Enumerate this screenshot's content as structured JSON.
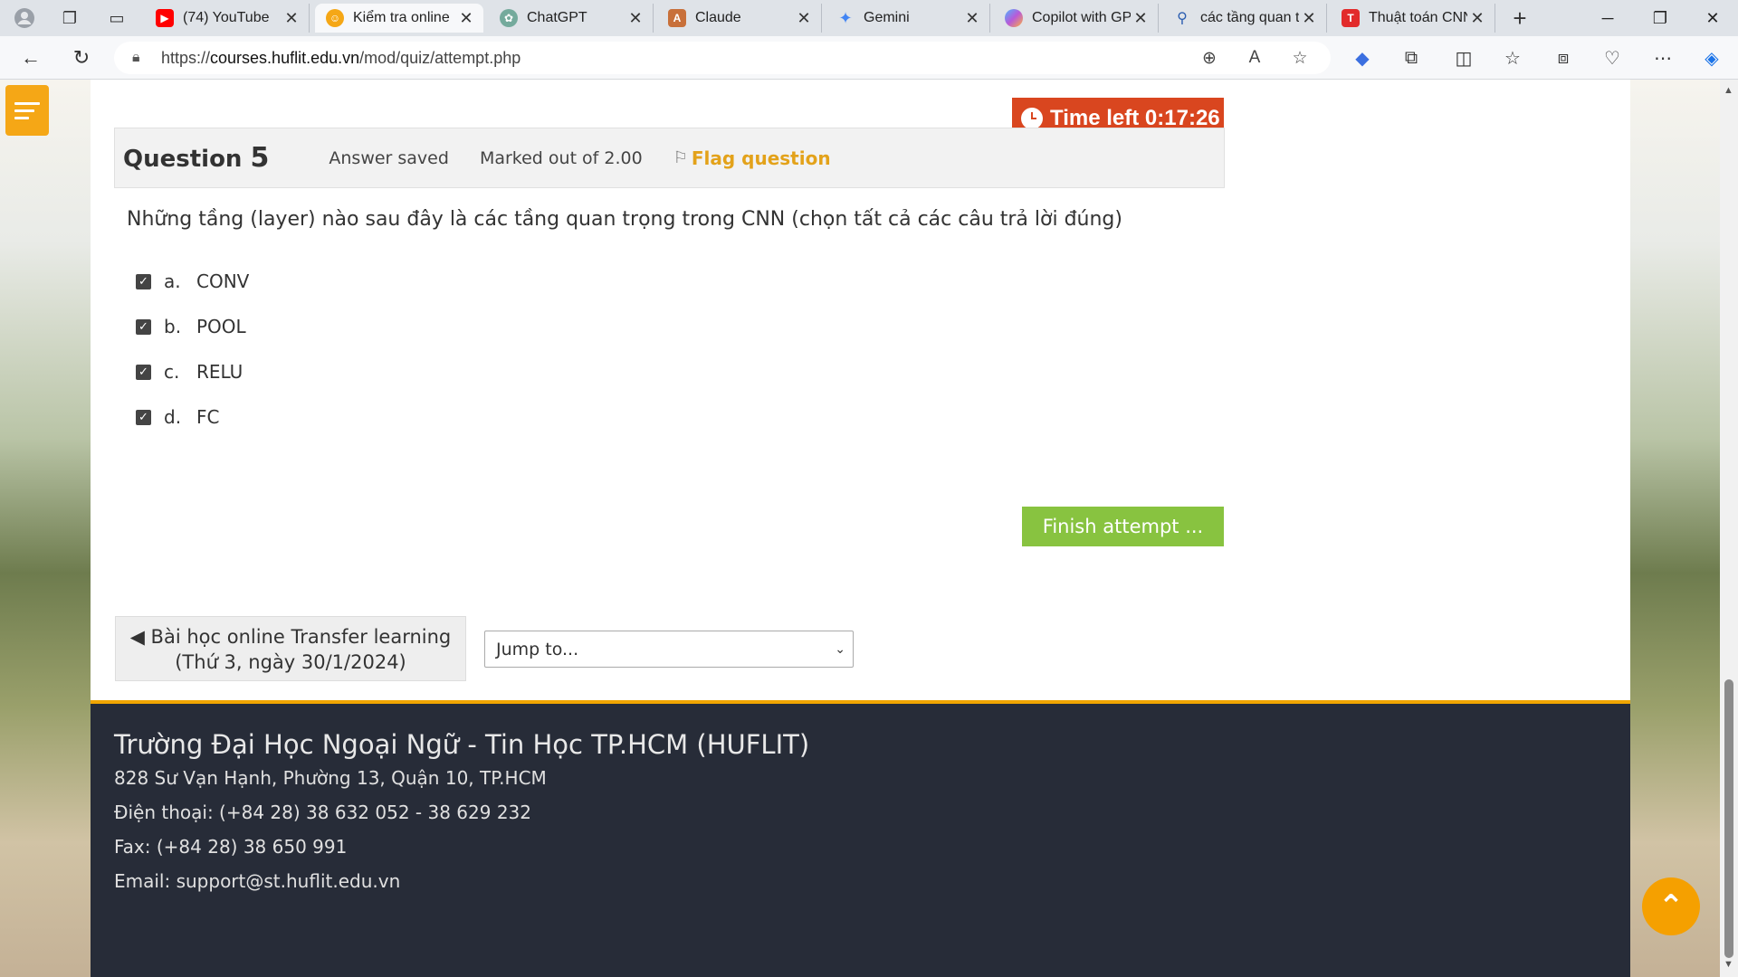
{
  "browser": {
    "tabs": [
      {
        "title": "(74) YouTube",
        "icon": "youtube-icon",
        "color": "#ff0000"
      },
      {
        "title": "Kiểm tra online",
        "icon": "moodle-icon",
        "color": "#f5a716",
        "active": true
      },
      {
        "title": "ChatGPT",
        "icon": "chatgpt-icon",
        "color": "#74aa9c"
      },
      {
        "title": "Claude",
        "icon": "claude-icon",
        "color": "#c8703a"
      },
      {
        "title": "Gemini",
        "icon": "gemini-icon",
        "color": "#4285f4"
      },
      {
        "title": "Copilot with GP",
        "icon": "copilot-icon",
        "color": "#9b59b6"
      },
      {
        "title": "các tầng quan t",
        "icon": "search-icon",
        "color": "#2a5db0"
      },
      {
        "title": "Thuật toán CNN",
        "icon": "t-icon",
        "color": "#e22b2b"
      }
    ],
    "url_scheme": "https://",
    "url_host": "courses.huflit.edu.vn",
    "url_path": "/mod/quiz/attempt.php"
  },
  "quiz": {
    "timer_label": "Time left 0:17:26",
    "question_label": "Question",
    "question_number": "5",
    "state": "Answer saved",
    "grade": "Marked out of 2.00",
    "flag_label": "Flag question",
    "question_text": "Những tầng (layer) nào sau đây là các tầng quan trọng trong CNN (chọn tất cả các câu trả lời đúng)",
    "answers": [
      {
        "letter": "a.",
        "text": "CONV",
        "checked": true
      },
      {
        "letter": "b.",
        "text": "POOL",
        "checked": true
      },
      {
        "letter": "c.",
        "text": "RELU",
        "checked": true
      },
      {
        "letter": "d.",
        "text": "FC",
        "checked": true
      }
    ],
    "finish_label": "Finish attempt ...",
    "prev_link": "◀ Bài học online Transfer learning (Thứ 3, ngày 30/1/2024)",
    "jump_label": "Jump to..."
  },
  "footer": {
    "title": "Trường Đại Học Ngoại Ngữ - Tin Học TP.HCM (HUFLIT)",
    "address": "828 Sư Vạn Hạnh, Phường 13, Quận 10, TP.HCM",
    "phone": "Điện thoại: (+84 28) 38 632 052 - 38 629 232",
    "fax": "Fax: (+84 28) 38 650 991",
    "email": "Email: support@st.huflit.edu.vn"
  }
}
